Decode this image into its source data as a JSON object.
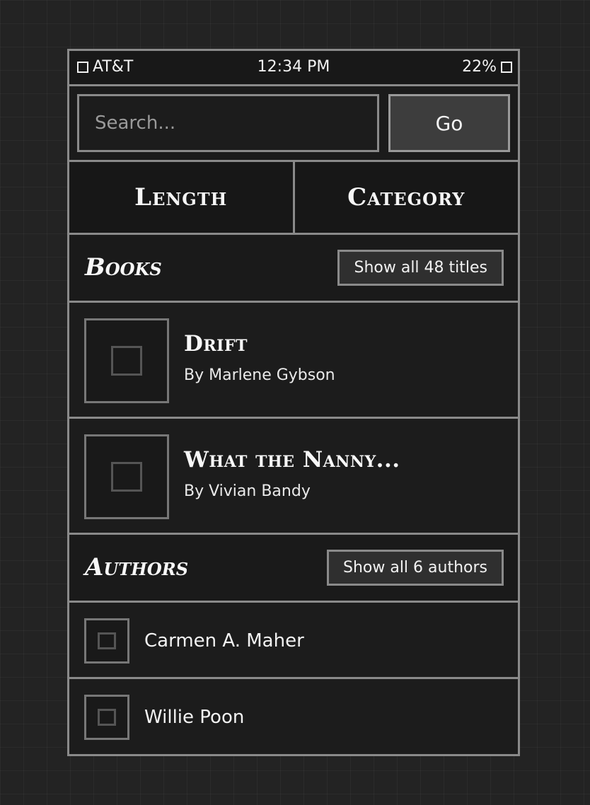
{
  "status_bar": {
    "carrier": "AT&T",
    "time": "12:34 PM",
    "battery": "22%"
  },
  "search": {
    "placeholder": "Search...",
    "go_label": "Go"
  },
  "tabs": [
    {
      "label": "Length"
    },
    {
      "label": "Category"
    }
  ],
  "books": {
    "heading": "Books",
    "show_all_label": "Show all 48 titles",
    "items": [
      {
        "title": "Drift",
        "author": "By Marlene Gybson"
      },
      {
        "title": "What the Nanny...",
        "author": "By Vivian Bandy"
      }
    ]
  },
  "authors": {
    "heading": "Authors",
    "show_all_label": "Show all 6 authors",
    "items": [
      {
        "name": "Carmen A. Maher"
      },
      {
        "name": "Willie Poon"
      }
    ]
  }
}
